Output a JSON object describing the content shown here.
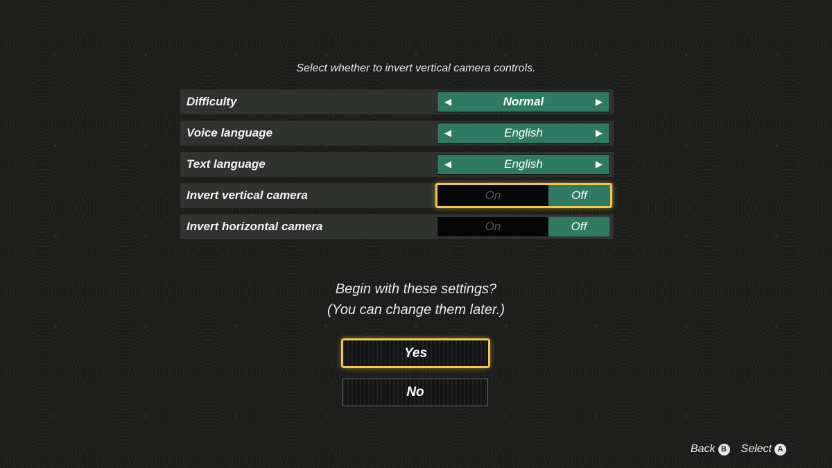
{
  "prompt_text": "Select whether to invert vertical camera controls.",
  "settings": [
    {
      "label": "Difficulty",
      "type": "selector",
      "value": "Normal"
    },
    {
      "label": "Voice language",
      "type": "selector",
      "value": "English"
    },
    {
      "label": "Text language",
      "type": "selector",
      "value": "English"
    },
    {
      "label": "Invert vertical camera",
      "type": "toggle",
      "on_label": "On",
      "off_label": "Off",
      "selected": "Off",
      "focused": true
    },
    {
      "label": "Invert horizontal camera",
      "type": "toggle",
      "on_label": "On",
      "off_label": "Off",
      "selected": "Off",
      "focused": false
    }
  ],
  "arrows": {
    "left": "◀",
    "right": "▶"
  },
  "question": {
    "line1": "Begin with these settings?",
    "line2": "(You can change them later.)"
  },
  "buttons": {
    "yes": "Yes",
    "no": "No",
    "focused": "yes"
  },
  "footer": {
    "back_label": "Back",
    "back_button": "B",
    "select_label": "Select",
    "select_button": "A"
  },
  "colors": {
    "accent_green": "#2e7a62",
    "focus_yellow": "#f2c94c"
  }
}
